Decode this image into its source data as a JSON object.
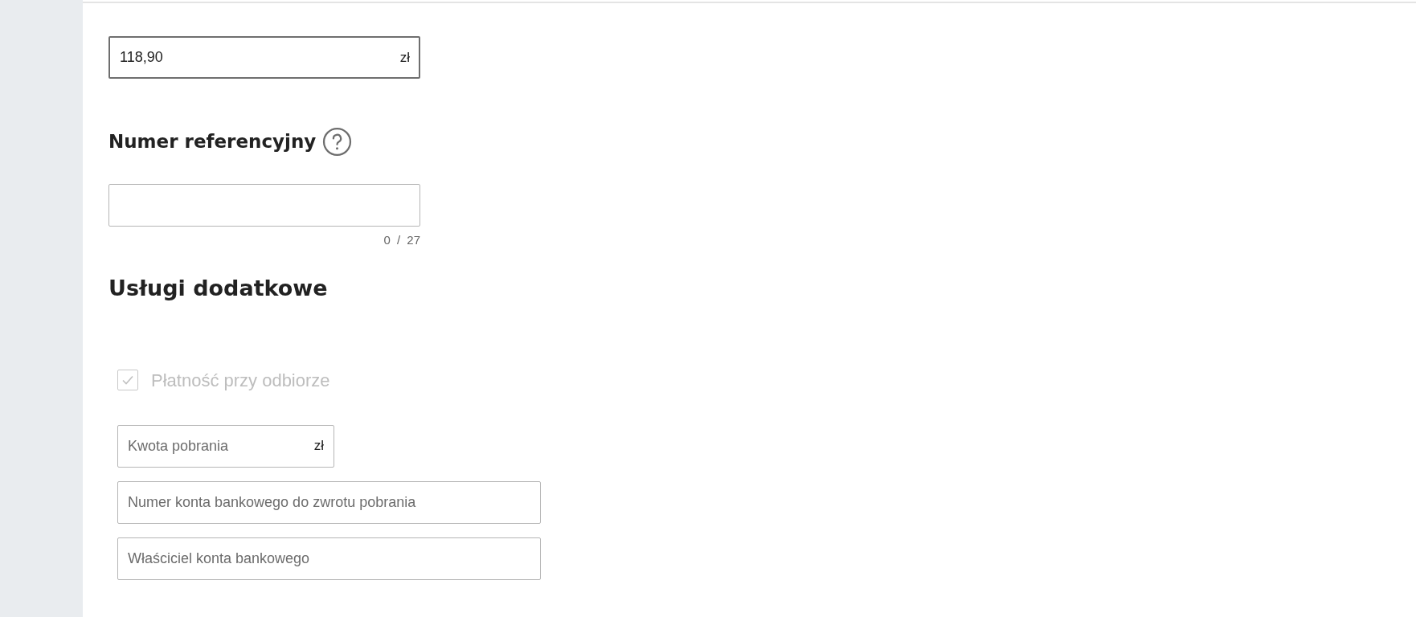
{
  "amount_field": {
    "value": "118,90",
    "suffix": "zł",
    "focused": true
  },
  "reference": {
    "label": "Numer referencyjny",
    "counter": "0 / 27"
  },
  "section_title": "Usługi dodatkowe",
  "cod_option": {
    "label": "Płatność przy odbiorze",
    "checked": true,
    "disabled": true
  },
  "cod_fields": [
    {
      "placeholder": "Kwota pobrania",
      "suffix": "zł",
      "kind": "amount"
    },
    {
      "placeholder": "Numer konta bankowego do zwrotu pobrania",
      "kind": "text"
    },
    {
      "placeholder": "Właściciel konta bankowego",
      "kind": "text"
    }
  ]
}
